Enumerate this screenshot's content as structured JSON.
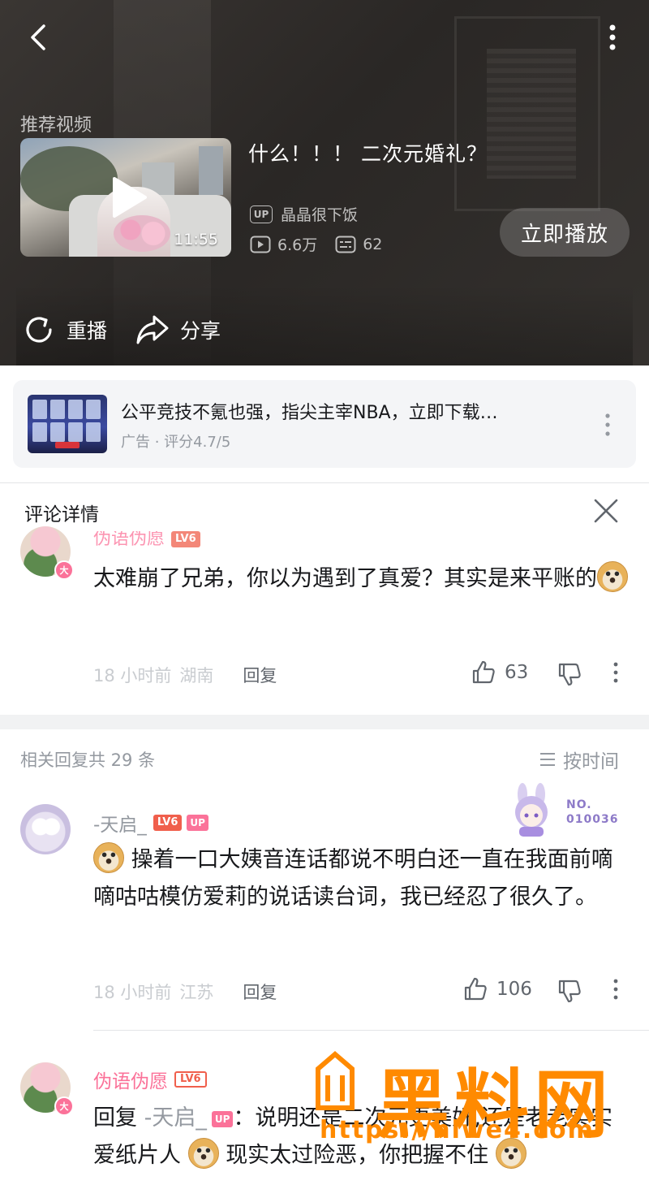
{
  "video": {
    "recommend_label": "推荐视频",
    "rec_title": "什么！！！ 二次元婚礼？",
    "duration": "11:55",
    "up_badge": "UP",
    "up_name": "晶晶很下饭",
    "views": "6.6万",
    "danmaku": "62",
    "play_now": "立即播放",
    "replay": "重播",
    "share": "分享"
  },
  "ad": {
    "title": "公平竞技不氪也强，指尖主宰NBA，立即下载…",
    "subtitle": "广告 · 评分4.7/5"
  },
  "detail": {
    "title": "评论详情",
    "main": {
      "name": "伪语伪愿",
      "level": "LV6",
      "text": "太难崩了兄弟，你以为遇到了真爱？其实是来平账的",
      "time": "18 小时前",
      "location": "湖南",
      "reply": "回复",
      "likes": "63"
    },
    "replies_count": "相关回复共 29 条",
    "sort": "按时间",
    "replies": [
      {
        "name": "-天启_",
        "level": "LV6",
        "up": "UP",
        "fan_no": "NO.",
        "fan_num": "010036",
        "text": "操着一口大姨音连话都说不明白还一直在我面前嘀嘀咕咕模仿爱莉的说话读台词，我已经忍了很久了。",
        "time": "18 小时前",
        "location": "江苏",
        "reply": "回复",
        "likes": "106"
      },
      {
        "name": "伪语伪愿",
        "level": "LV6",
        "reply_prefix": "回复",
        "reply_target": "-天启_",
        "target_up": "UP",
        "colon": "：",
        "text_a": "说明还是二次元更美好,还是老老实实爱纸片人",
        "text_b": "现实太过险恶，你把握不住"
      }
    ]
  },
  "watermark": {
    "glyph": "黑料网",
    "url": "https://hlwe4.com"
  },
  "colors": {
    "pink": "#fb7299",
    "level_red": "#f05f4c",
    "gray_text": "#9499a0",
    "watermark_orange": "#ff8a00"
  }
}
